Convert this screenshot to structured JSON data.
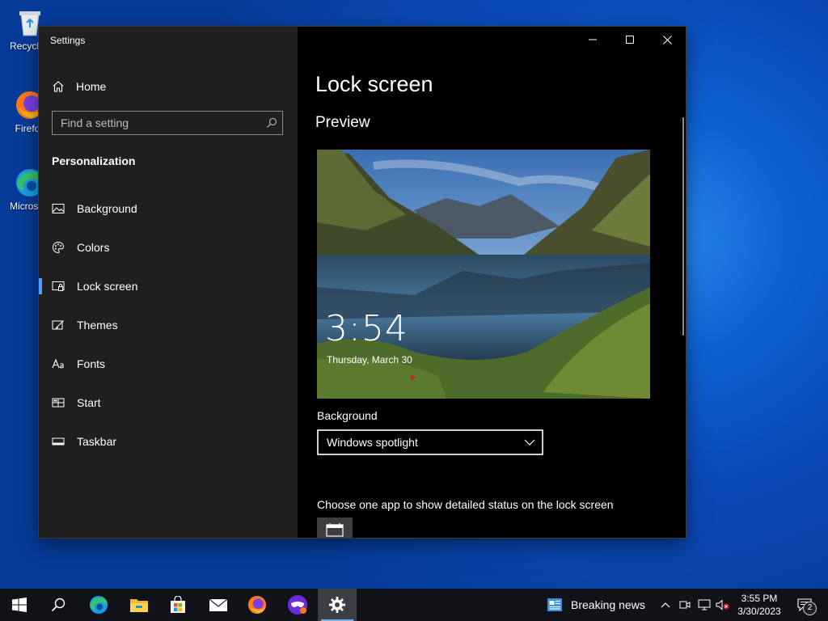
{
  "desktop": {
    "icons": [
      {
        "label": "Recycle Bin"
      },
      {
        "label": "Firefox"
      },
      {
        "label": "Microsoft Edge"
      }
    ]
  },
  "window": {
    "title": "Settings",
    "minimize_icon": "minimize-icon",
    "maximize_icon": "maximize-icon",
    "close_icon": "close-icon"
  },
  "sidebar": {
    "home_label": "Home",
    "search_placeholder": "Find a setting",
    "category": "Personalization",
    "items": [
      {
        "label": "Background",
        "icon": "picture-icon"
      },
      {
        "label": "Colors",
        "icon": "palette-icon"
      },
      {
        "label": "Lock screen",
        "icon": "lock-screen-icon",
        "selected": true
      },
      {
        "label": "Themes",
        "icon": "themes-brush-icon"
      },
      {
        "label": "Fonts",
        "icon": "fonts-icon"
      },
      {
        "label": "Start",
        "icon": "start-grid-icon"
      },
      {
        "label": "Taskbar",
        "icon": "taskbar-icon"
      }
    ]
  },
  "main": {
    "title": "Lock screen",
    "preview_heading": "Preview",
    "preview_time": "3:54",
    "preview_date": "Thursday, March 30",
    "background_label": "Background",
    "background_value": "Windows spotlight",
    "status_label": "Choose one app to show detailed status on the lock screen"
  },
  "taskbar": {
    "news": "Breaking news",
    "clock_time": "3:55 PM",
    "clock_date": "3/30/2023",
    "notification_count": "2"
  },
  "colors": {
    "accent": "#4aa3ff",
    "sidebar_bg": "#1f1f1f",
    "content_bg": "#000000",
    "desktop_blue": "#0a4cba"
  }
}
